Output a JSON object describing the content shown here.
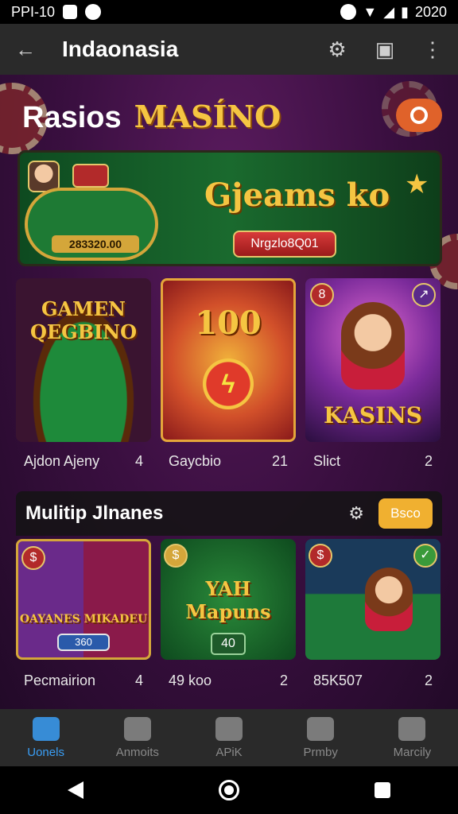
{
  "status_bar": {
    "carrier": "PPI-10",
    "time": "2020"
  },
  "app_bar": {
    "title": "Indaonasia"
  },
  "headline": {
    "word1": "Rasios",
    "word2": "MASÍNO"
  },
  "banner": {
    "title": "Gjeams ko",
    "amount": "283320.00",
    "button_label": "Nrgzlo8Q01"
  },
  "featured_cards": [
    {
      "image_title": "GAMEN QEGBINO",
      "caption": "Ajdon Ajeny",
      "count": "4"
    },
    {
      "image_title": "100",
      "caption": "Gaycbio",
      "count": "21"
    },
    {
      "image_title": "KASINS",
      "caption": "Slict",
      "count": "2"
    }
  ],
  "section": {
    "title": "Mulitip Jlnanes",
    "button_label": "Bsco",
    "cards": [
      {
        "image_title": "OAYANES MIKADEU",
        "pill": "360",
        "caption": "Pecmairion",
        "count": "4"
      },
      {
        "image_title": "YAH Mapuns",
        "pill": "40",
        "caption": "49 koo",
        "count": "2"
      },
      {
        "image_title": "",
        "pill": "",
        "caption": "85K507",
        "count": "2"
      }
    ]
  },
  "bottom_nav": [
    {
      "label": "Uonels",
      "active": true
    },
    {
      "label": "Anmoits",
      "active": false
    },
    {
      "label": "APiK",
      "active": false
    },
    {
      "label": "Prmby",
      "active": false
    },
    {
      "label": "Marcily",
      "active": false
    }
  ],
  "colors": {
    "accent": "#f5c542",
    "nav_active": "#3a9ef5",
    "section_button": "#f0b030"
  },
  "icons": [
    "back-arrow-icon",
    "search-icon",
    "cast-icon",
    "more-vert-icon",
    "power-icon",
    "settings-icon",
    "home-icon"
  ]
}
